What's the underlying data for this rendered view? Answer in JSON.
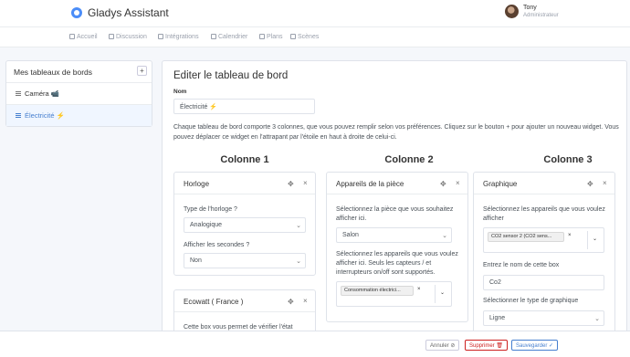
{
  "app": {
    "title": "Gladys Assistant"
  },
  "user": {
    "name": "Tony",
    "role": "Administrateur"
  },
  "nav": [
    "Accueil",
    "Discussion",
    "Intégrations",
    "Calendrier",
    "Plans",
    "Scènes"
  ],
  "sidebar": {
    "title": "Mes tableaux de bords",
    "add_label": "+",
    "items": [
      {
        "label": "Caméra 📹"
      },
      {
        "label": "Électricité ⚡"
      }
    ]
  },
  "editor": {
    "title": "Editer le tableau de bord",
    "name_label": "Nom",
    "name_value": "Électricité ⚡",
    "description": "Chaque tableau de bord comporte 3 colonnes, que vous pouvez remplir selon vos préférences. Cliquez sur le bouton + pour ajouter un nouveau widget. Vous pouvez déplacer ce widget en l'attrapant par l'étoile en haut à droite de celui-ci.",
    "columns": [
      "Colonne 1",
      "Colonne 2",
      "Colonne 3"
    ]
  },
  "widgets": {
    "clock": {
      "title": "Horloge",
      "type_label": "Type de l'horloge ?",
      "type_value": "Analogique",
      "seconds_label": "Afficher les secondes ?",
      "seconds_value": "Non"
    },
    "ecowatt": {
      "title": "Ecowatt ( France )",
      "desc": "Cette box vous permet de vérifier l'état"
    },
    "room_devices": {
      "title": "Appareils de la pièce",
      "room_label": "Sélectionnez la pièce que vous souhaitez afficher ici.",
      "room_value": "Salon",
      "devices_label": "Sélectionnez les appareils que vous voulez afficher ici. Seuls les capteurs / et interrupteurs on/off sont supportés.",
      "device_tag": "Consommation électrici..."
    },
    "chart": {
      "title": "Graphique",
      "devices_label": "Sélectionnez les appareils que vous voulez afficher",
      "device_tag": "CO2 sensor 2 (CO2 sens...",
      "name_label": "Entrez le nom de cette box",
      "name_value": "Co2",
      "type_label": "Sélectionner le type de graphique",
      "type_value": "Ligne"
    }
  },
  "footer": {
    "cancel": "Annuler",
    "delete": "Supprimer",
    "save": "Sauvegarder"
  },
  "icons": {
    "move": "✥",
    "close": "×",
    "chevron": "⌄"
  },
  "colors": {
    "primary": "#467fcf",
    "danger": "#cd201f",
    "muted": "#9aa0ac"
  }
}
